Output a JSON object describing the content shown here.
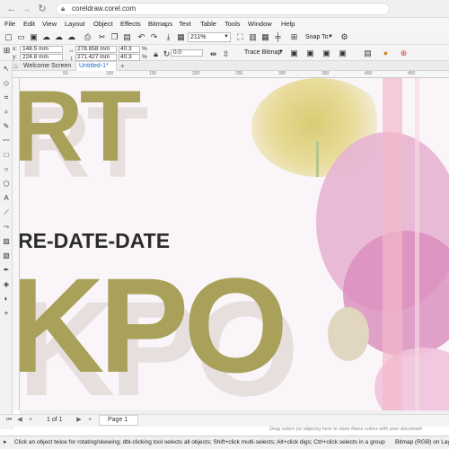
{
  "browser": {
    "url": "coreldraw.corel.com"
  },
  "menu": [
    "File",
    "Edit",
    "View",
    "Layout",
    "Object",
    "Effects",
    "Bitmaps",
    "Text",
    "Table",
    "Tools",
    "Window",
    "Help"
  ],
  "toolbar": {
    "zoom": "211%",
    "snap_to": "Snap To"
  },
  "property_bar": {
    "x_label": "x:",
    "x_value": "148.5 mm",
    "y_label": "y:",
    "y_value": "224.8 mm",
    "w_value": "278.858 mm",
    "h_value": "271.427 mm",
    "scale_w": "40.3",
    "scale_h": "40.3",
    "percent": "%",
    "rotation": "0.0",
    "trace_bitmap": "Trace Bitmap"
  },
  "tabs": {
    "welcome": "Welcome Screen",
    "document": "Untitled-1*",
    "add": "+"
  },
  "ruler_labels": [
    "50",
    "100",
    "150",
    "200",
    "250",
    "300",
    "350",
    "400",
    "450"
  ],
  "artwork": {
    "headline_top": "RT",
    "date_text": "RE-DATE-DATE",
    "headline_bottom": "KPO"
  },
  "page_nav": {
    "count": "1  of  1",
    "page_tab": "Page 1"
  },
  "drop_hint": "Drag colors (or objects) here to store these colors with your document",
  "status": {
    "message": "Click an object twice for rotating/skewing; dbl-clicking tool selects all objects; Shift+click multi-selects; Alt+click digs; Ctrl+click selects in a group",
    "right": "Bitmap (RGB) on Layer"
  },
  "colors": {
    "olive": "#a9a05a",
    "shadow": "#e7dede",
    "orchid": "#d98cbc",
    "accent_blue": "#2266cc"
  }
}
